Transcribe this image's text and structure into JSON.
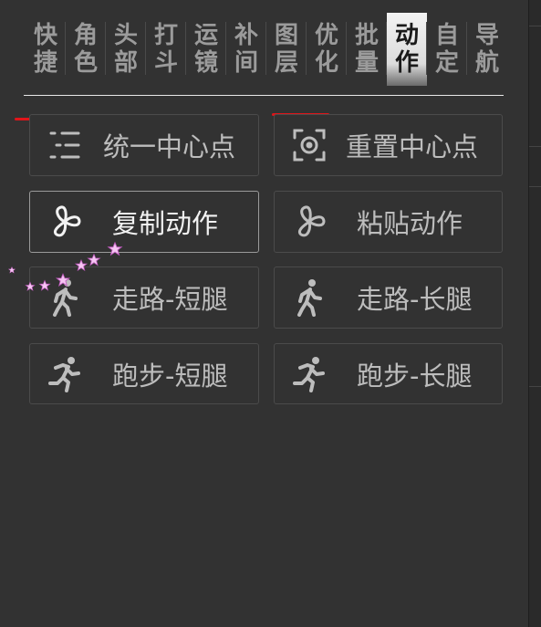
{
  "tabs": [
    {
      "label": "快捷"
    },
    {
      "label": "角色"
    },
    {
      "label": "头部"
    },
    {
      "label": "打斗"
    },
    {
      "label": "运镜"
    },
    {
      "label": "补间"
    },
    {
      "label": "图层"
    },
    {
      "label": "优化"
    },
    {
      "label": "批量"
    },
    {
      "label": "动作",
      "active": true
    },
    {
      "label": "自定"
    },
    {
      "label": "导航"
    }
  ],
  "actions": {
    "unify_center": "统一中心点",
    "reset_center": "重置中心点",
    "copy_action": "复制动作",
    "paste_action": "粘贴动作",
    "walk_short": "走路-短腿",
    "walk_long": "走路-长腿",
    "run_short": "跑步-短腿",
    "run_long": "跑步-长腿"
  },
  "colors": {
    "background": "#323232",
    "accent_red": "#e0151a",
    "active_tab": "#ececec"
  }
}
